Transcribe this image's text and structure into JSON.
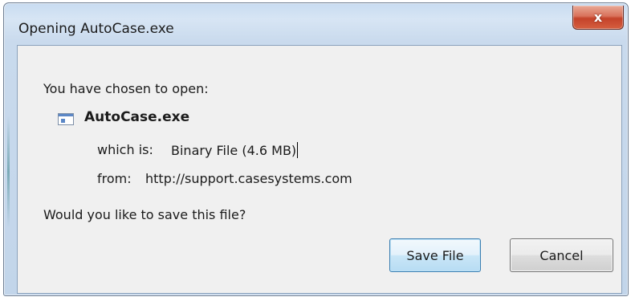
{
  "window": {
    "title": "Opening AutoCase.exe",
    "close_symbol": "x"
  },
  "dialog": {
    "prompt": "You have chosen to open:",
    "file": {
      "icon": "executable-file-icon",
      "name": "AutoCase.exe",
      "type_label": "which is:",
      "type_value": "Binary File (4.6 MB)",
      "from_label": "from:",
      "from_value": "http://support.casesystems.com"
    },
    "question": "Would you like to save this file?",
    "buttons": {
      "save_label": "Save File",
      "cancel_label": "Cancel"
    }
  },
  "colors": {
    "close_button": "#c4432a",
    "frame": "#c8dcf1",
    "save_button_border": "#3c7fb1"
  }
}
